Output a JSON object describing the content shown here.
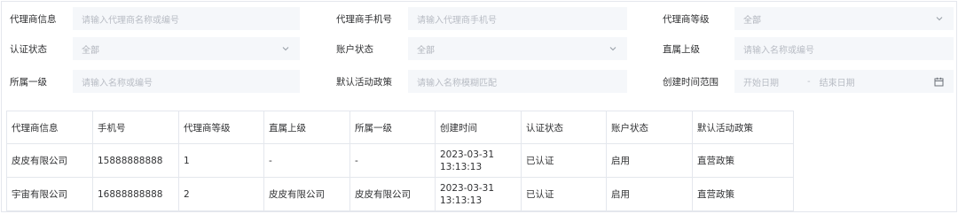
{
  "filters": {
    "agent_info": {
      "label": "代理商信息",
      "placeholder": "请输入代理商名称或编号"
    },
    "agent_phone": {
      "label": "代理商手机号",
      "placeholder": "请输入代理商手机号"
    },
    "agent_level": {
      "label": "代理商等级",
      "value": "全部",
      "icon": "chevron-down-icon"
    },
    "auth_status": {
      "label": "认证状态",
      "value": "全部",
      "icon": "chevron-down-icon"
    },
    "account_status": {
      "label": "账户状态",
      "value": "全部",
      "icon": "chevron-down-icon"
    },
    "direct_superior": {
      "label": "直属上级",
      "placeholder": "请输入名称或编号"
    },
    "first_level": {
      "label": "所属一级",
      "placeholder": "请输入名称或编号"
    },
    "default_policy": {
      "label": "默认活动政策",
      "placeholder": "请输入名称模糊匹配"
    },
    "created_range": {
      "label": "创建时间范围",
      "start_placeholder": "开始日期",
      "separator": "-",
      "end_placeholder": "结束日期",
      "icon": "calendar-icon"
    }
  },
  "table": {
    "headers": [
      "代理商信息",
      "手机号",
      "代理商等级",
      "直属上级",
      "所属一级",
      "创建时间",
      "认证状态",
      "账户状态",
      "默认活动政策"
    ],
    "rows": [
      [
        "皮皮有限公司",
        "15888888888",
        "1",
        "-",
        "-",
        "2023-03-31 13:13:13",
        "已认证",
        "启用",
        "直营政策"
      ],
      [
        "宇宙有限公司",
        "16888888888",
        "2",
        "皮皮有限公司",
        "皮皮有限公司",
        "2023-03-31 13:13:13",
        "已认证",
        "启用",
        "直营政策"
      ]
    ]
  },
  "colors": {
    "field_bg": "#f5f7fa",
    "border": "#e4e7ed",
    "text": "#303133",
    "placeholder": "#b8bcc4"
  }
}
